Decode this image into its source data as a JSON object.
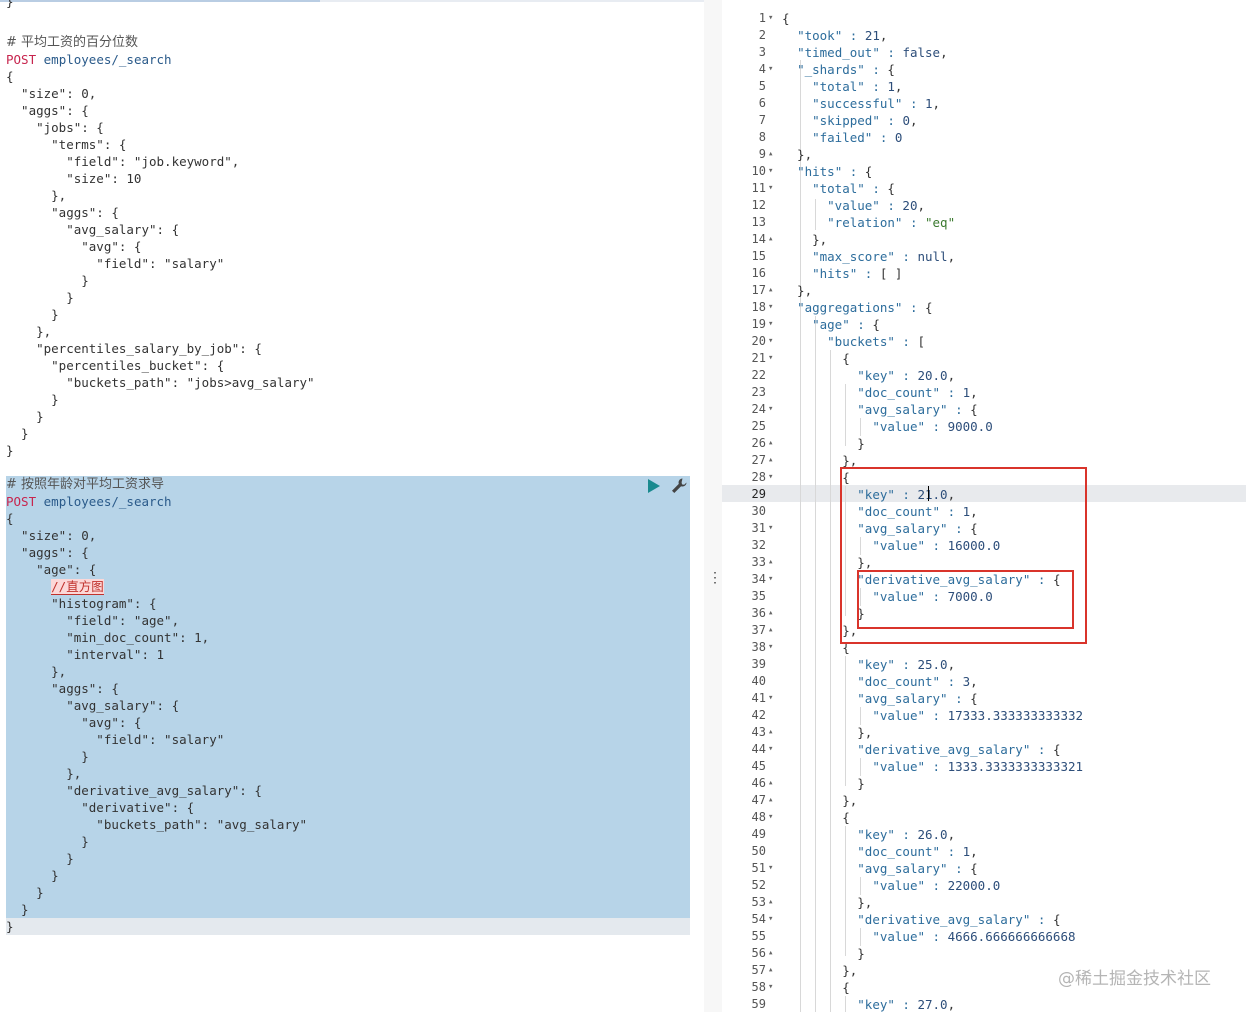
{
  "left_editor": {
    "top_fragment": "}",
    "request1": {
      "comment": "# 平均工资的百分位数",
      "method": "POST",
      "path": "employees/_search",
      "lines": [
        "{",
        "  \"size\": 0,",
        "  \"aggs\": {",
        "    \"jobs\": {",
        "      \"terms\": {",
        "        \"field\": \"job.keyword\",",
        "        \"size\": 10",
        "      },",
        "      \"aggs\": {",
        "        \"avg_salary\": {",
        "          \"avg\": {",
        "            \"field\": \"salary\"",
        "          }",
        "        }",
        "      }",
        "    },",
        "    \"percentiles_salary_by_job\": {",
        "      \"percentiles_bucket\": {",
        "        \"buckets_path\": \"jobs>avg_salary\"",
        "      }",
        "    }",
        "  }",
        "}"
      ]
    },
    "request2": {
      "comment": "# 按照年龄对平均工资求导",
      "method": "POST",
      "path": "employees/_search",
      "inline_comment": "//直方图",
      "lines": [
        "{",
        "  \"size\": 0,",
        "  \"aggs\": {",
        "    \"age\": {",
        "",
        "      \"histogram\": {",
        "        \"field\": \"age\",",
        "        \"min_doc_count\": 1,",
        "        \"interval\": 1",
        "      },",
        "      \"aggs\": {",
        "        \"avg_salary\": {",
        "          \"avg\": {",
        "            \"field\": \"salary\"",
        "          }",
        "        },",
        "        \"derivative_avg_salary\": {",
        "          \"derivative\": {",
        "            \"buckets_path\": \"avg_salary\"",
        "          }",
        "        }",
        "      }",
        "    }",
        "  }",
        "}"
      ]
    },
    "buttons": {
      "run": "run-icon",
      "settings": "wrench-icon"
    }
  },
  "response": {
    "line_numbers": [
      "1",
      "2",
      "3",
      "4",
      "5",
      "6",
      "7",
      "8",
      "9",
      "10",
      "11",
      "12",
      "13",
      "14",
      "15",
      "16",
      "17",
      "18",
      "19",
      "20",
      "21",
      "22",
      "23",
      "24",
      "25",
      "26",
      "27",
      "28",
      "29",
      "30",
      "31",
      "32",
      "33",
      "34",
      "35",
      "36",
      "37",
      "38",
      "39",
      "40",
      "41",
      "42",
      "43",
      "44",
      "45",
      "46",
      "47",
      "48",
      "49",
      "50",
      "51",
      "52",
      "53",
      "54",
      "55",
      "56",
      "57",
      "58",
      "59"
    ],
    "lines": [
      "{",
      "  \"took\" : 21,",
      "  \"timed_out\" : false,",
      "  \"_shards\" : {",
      "    \"total\" : 1,",
      "    \"successful\" : 1,",
      "    \"skipped\" : 0,",
      "    \"failed\" : 0",
      "  },",
      "  \"hits\" : {",
      "    \"total\" : {",
      "      \"value\" : 20,",
      "      \"relation\" : \"eq\"",
      "    },",
      "    \"max_score\" : null,",
      "    \"hits\" : [ ]",
      "  },",
      "  \"aggregations\" : {",
      "    \"age\" : {",
      "      \"buckets\" : [",
      "        {",
      "          \"key\" : 20.0,",
      "          \"doc_count\" : 1,",
      "          \"avg_salary\" : {",
      "            \"value\" : 9000.0",
      "          }",
      "        },",
      "        {",
      "          \"key\" : 21.0,",
      "          \"doc_count\" : 1,",
      "          \"avg_salary\" : {",
      "            \"value\" : 16000.0",
      "          },",
      "          \"derivative_avg_salary\" : {",
      "            \"value\" : 7000.0",
      "          }",
      "        },",
      "        {",
      "          \"key\" : 25.0,",
      "          \"doc_count\" : 3,",
      "          \"avg_salary\" : {",
      "            \"value\" : 17333.333333333332",
      "          },",
      "          \"derivative_avg_salary\" : {",
      "            \"value\" : 1333.3333333333321",
      "          }",
      "        },",
      "        {",
      "          \"key\" : 26.0,",
      "          \"doc_count\" : 1,",
      "          \"avg_salary\" : {",
      "            \"value\" : 22000.0",
      "          },",
      "          \"derivative_avg_salary\" : {",
      "            \"value\" : 4666.666666666668",
      "          }",
      "        },",
      "        {",
      "          \"key\" : 27.0,"
    ]
  },
  "watermark": "@稀土掘金技术社区",
  "colors": {
    "selection": "#b7d4e8",
    "annotation_box": "#d9342b",
    "method": "#c7254e"
  }
}
